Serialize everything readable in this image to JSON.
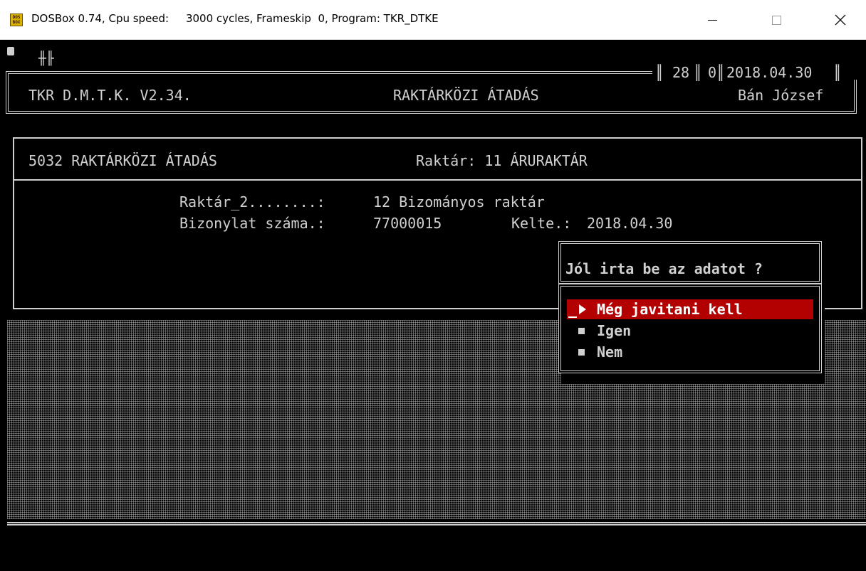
{
  "window": {
    "app_icon_text": "DOS BOX",
    "title": "DOSBox 0.74, Cpu speed:     3000 cycles, Frameskip  0, Program: TKR_DTKE"
  },
  "header": {
    "app_name": "TKR D.M.T.K. V2.34.",
    "screen_title": "RAKTÁRKÖZI ÁTADÁS",
    "status_counter_1": "28",
    "status_counter_2": "0",
    "date": "2018.04.30",
    "user": "Bán József"
  },
  "panel": {
    "title": "5032 RAKTÁRKÖZI ÁTADÁS",
    "warehouse": "Raktár: 11 ÁRURAKTÁR",
    "field_1_label": "Raktár_2........:",
    "field_1_value": "12 Bizományos raktár",
    "field_2_label": "Bizonylat száma.:",
    "field_2_value": "77000015",
    "field_3_label": "Kelte.:",
    "field_3_value": "2018.04.30"
  },
  "dialog": {
    "question": "Jól irta be az adatot ?",
    "options": [
      {
        "label": "Még javitani kell",
        "selected": true
      },
      {
        "label": "Igen",
        "selected": false
      },
      {
        "label": "Nem",
        "selected": false
      }
    ]
  },
  "colors": {
    "highlight": "#b30000",
    "text": "#d0d0d0",
    "background": "#000000"
  }
}
